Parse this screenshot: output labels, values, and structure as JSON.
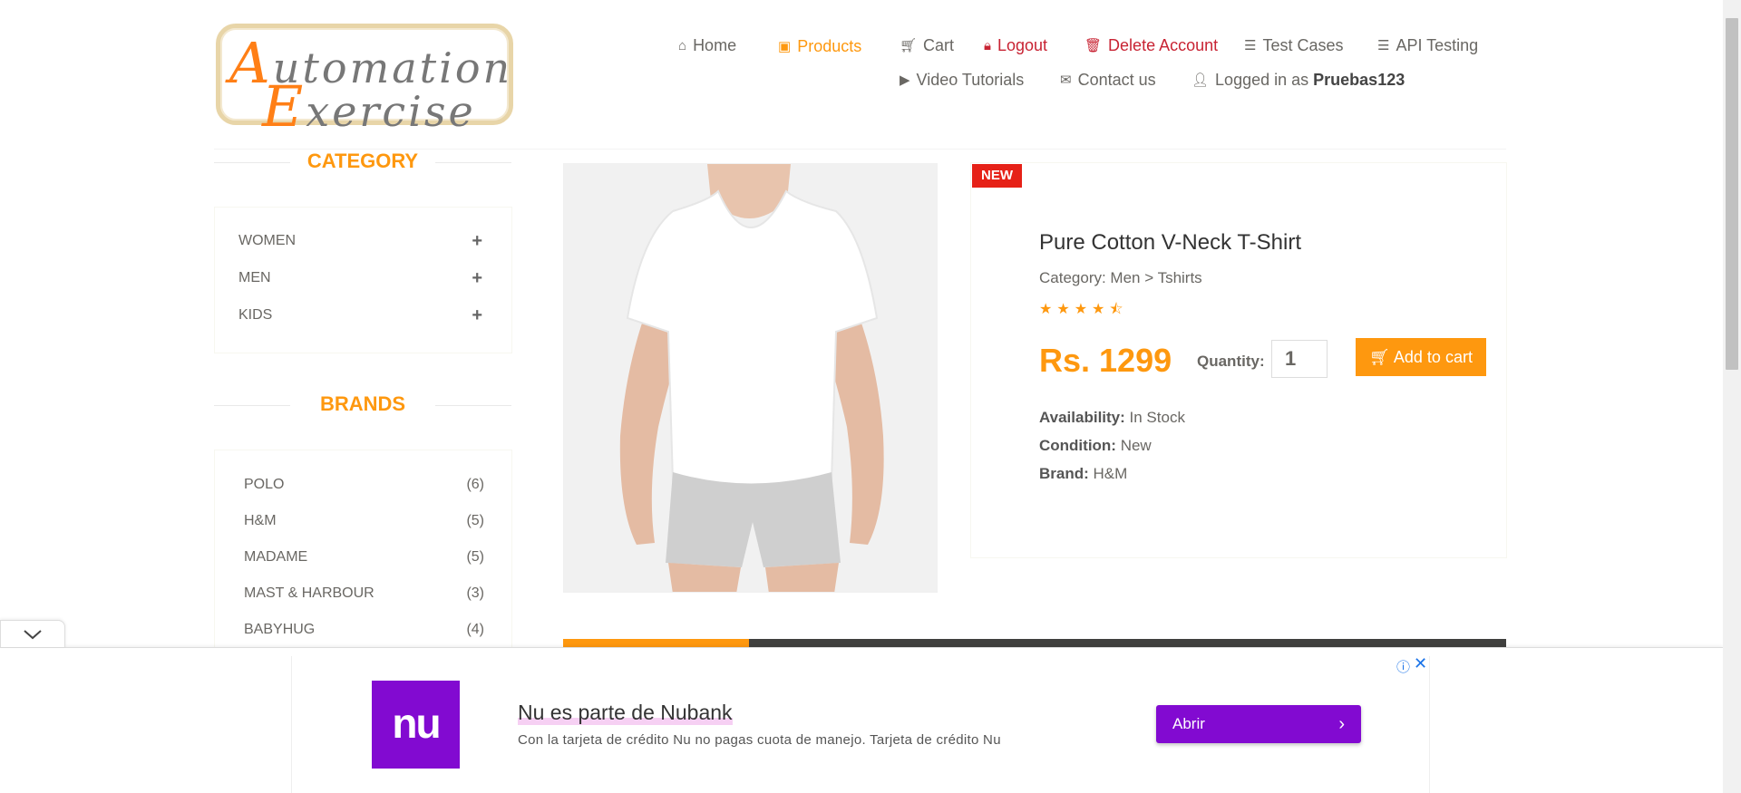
{
  "logo": {
    "line1_big": "A",
    "line1_rest": "utomation",
    "line2_big": "E",
    "line2_rest": "xercise"
  },
  "nav": {
    "home": "Home",
    "products": "Products",
    "cart": "Cart",
    "logout": "Logout",
    "delete_account": "Delete Account",
    "test_cases": "Test Cases",
    "api_testing": "API Testing",
    "video_tutorials": "Video Tutorials",
    "contact_us": "Contact us",
    "logged_in_prefix": "Logged in as",
    "username": "Pruebas123"
  },
  "sidebar": {
    "category_title": "CATEGORY",
    "categories": [
      "WOMEN",
      "MEN",
      "KIDS"
    ],
    "brands_title": "BRANDS",
    "brands": [
      {
        "name": "POLO",
        "count": "(6)"
      },
      {
        "name": "H&M",
        "count": "(5)"
      },
      {
        "name": "MADAME",
        "count": "(5)"
      },
      {
        "name": "MAST & HARBOUR",
        "count": "(3)"
      },
      {
        "name": "BABYHUG",
        "count": "(4)"
      }
    ]
  },
  "product": {
    "badge": "NEW",
    "name": "Pure Cotton V-Neck T-Shirt",
    "category": "Category: Men > Tshirts",
    "rating": 4.5,
    "price": "Rs. 1299",
    "quantity_label": "Quantity:",
    "quantity_value": "1",
    "add_to_cart": "Add to cart",
    "availability_label": "Availability:",
    "availability": "In Stock",
    "condition_label": "Condition:",
    "condition": "New",
    "brand_label": "Brand:",
    "brand": "H&M"
  },
  "ad": {
    "logo_text": "nu",
    "title": "Nu es parte de Nubank",
    "description": "Con la tarjeta de crédito Nu no pagas cuota de manejo. Tarjeta de crédito Nu",
    "cta": "Abrir"
  },
  "colors": {
    "accent": "#fe980f",
    "danger": "#c82333",
    "ad_purple": "#820ad1",
    "badge_red": "#e62117"
  },
  "icons": [
    "home-icon",
    "briefcase-icon",
    "cart-icon",
    "lock-icon",
    "trash-icon",
    "list-icon",
    "youtube-icon",
    "envelope-icon",
    "user-icon",
    "plus-icon",
    "star-icon",
    "chevron-down-icon",
    "chevron-right-icon",
    "info-icon",
    "close-icon"
  ]
}
